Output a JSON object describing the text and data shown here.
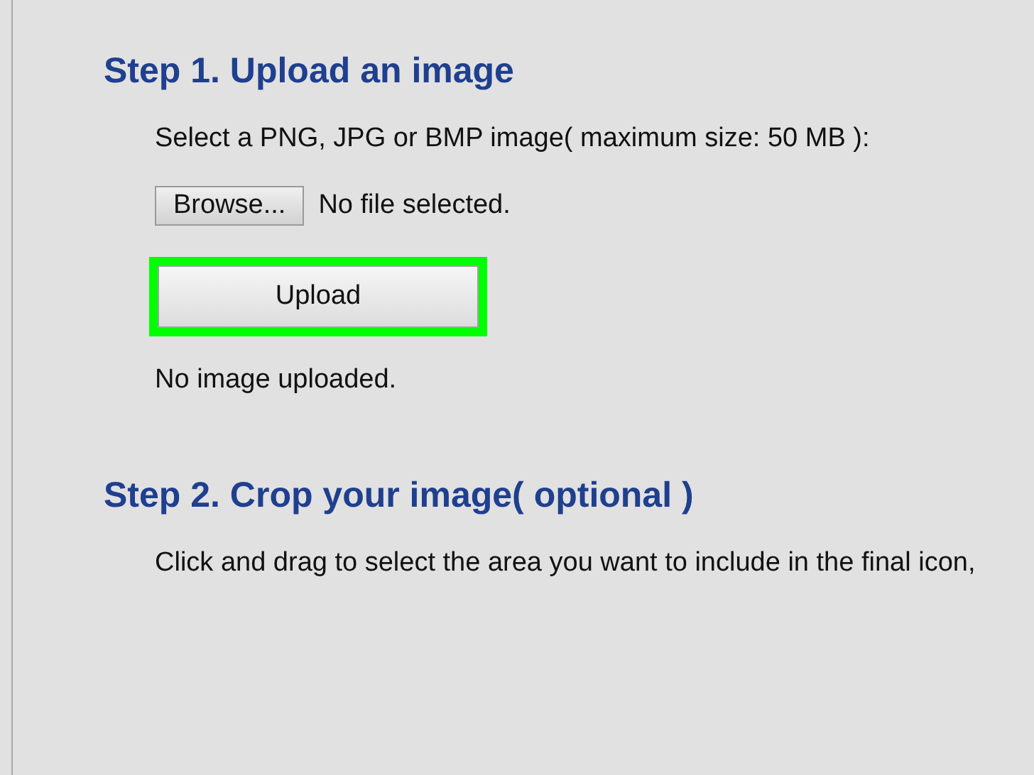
{
  "sections": [
    {
      "title": "Step 1. Upload an image",
      "instruction": "Select a PNG, JPG or BMP image( maximum size: 50 MB ):",
      "file_picker": {
        "button": "Browse...",
        "status": "No file selected."
      },
      "upload_button": {
        "label": "Upload",
        "highlighted": true
      },
      "result": "No image uploaded."
    },
    {
      "title": "Step 2. Crop your image( optional )",
      "instruction": "Click and drag to select the area you want to include in the final icon,"
    }
  ]
}
